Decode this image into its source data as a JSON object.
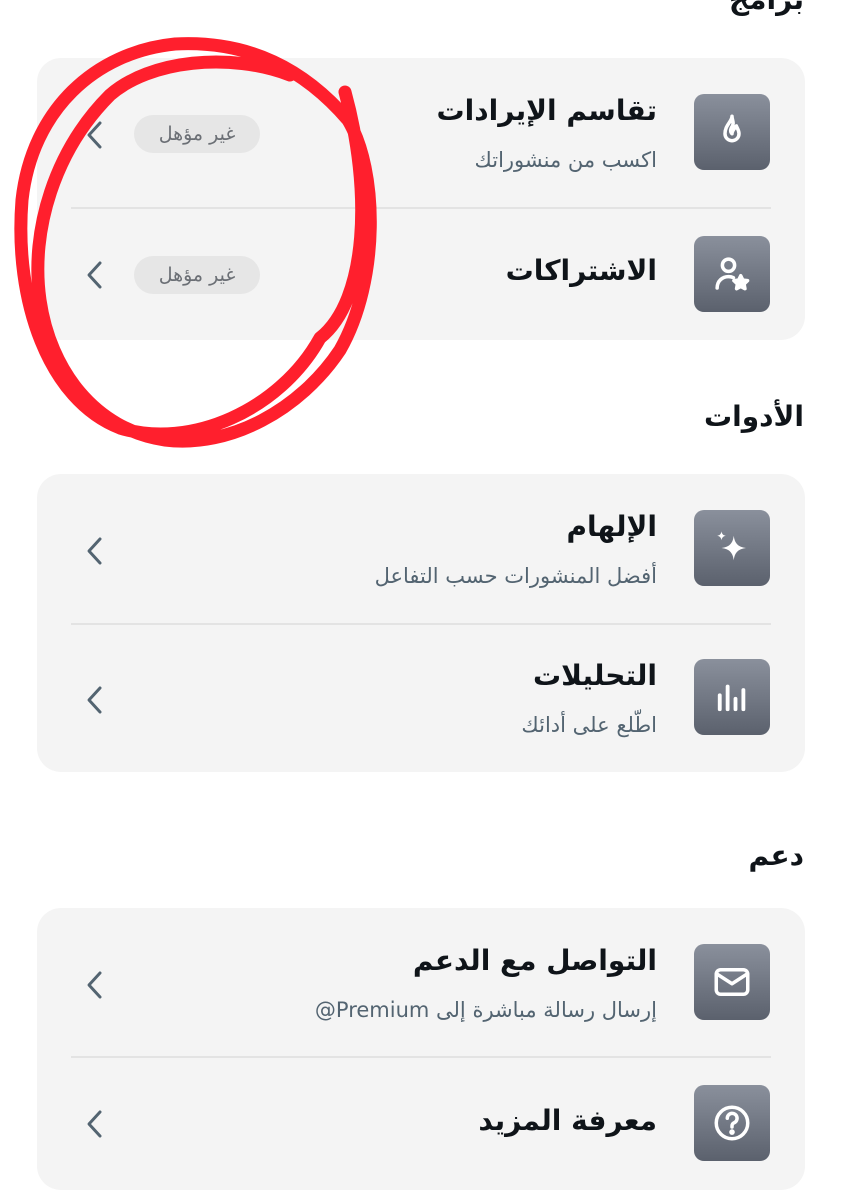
{
  "sections": {
    "programs": {
      "title": "برامج",
      "items": [
        {
          "title": "تقاسم الإيرادات",
          "subtitle": "اكسب من منشوراتك",
          "badge": "غير مؤهل",
          "icon": "flame-icon"
        },
        {
          "title": "الاشتراكات",
          "subtitle": "",
          "badge": "غير مؤهل",
          "icon": "person-star-icon"
        }
      ]
    },
    "tools": {
      "title": "الأدوات",
      "items": [
        {
          "title": "الإلهام",
          "subtitle": "أفضل المنشورات حسب التفاعل",
          "icon": "sparkle-icon"
        },
        {
          "title": "التحليلات",
          "subtitle": "اطّلع على أدائك",
          "icon": "bar-chart-icon"
        }
      ]
    },
    "support": {
      "title": "دعم",
      "items": [
        {
          "title": "التواصل مع الدعم",
          "subtitle": "إرسال رسالة مباشرة إلى Premium@",
          "icon": "envelope-icon"
        },
        {
          "title": "معرفة المزيد",
          "subtitle": "",
          "icon": "question-circle-icon"
        }
      ]
    }
  },
  "colors": {
    "card_bg": "#f4f4f4",
    "icon_bg": "#6b717d",
    "badge_bg": "#e6e6e6",
    "annotation": "#ff1f2d"
  }
}
